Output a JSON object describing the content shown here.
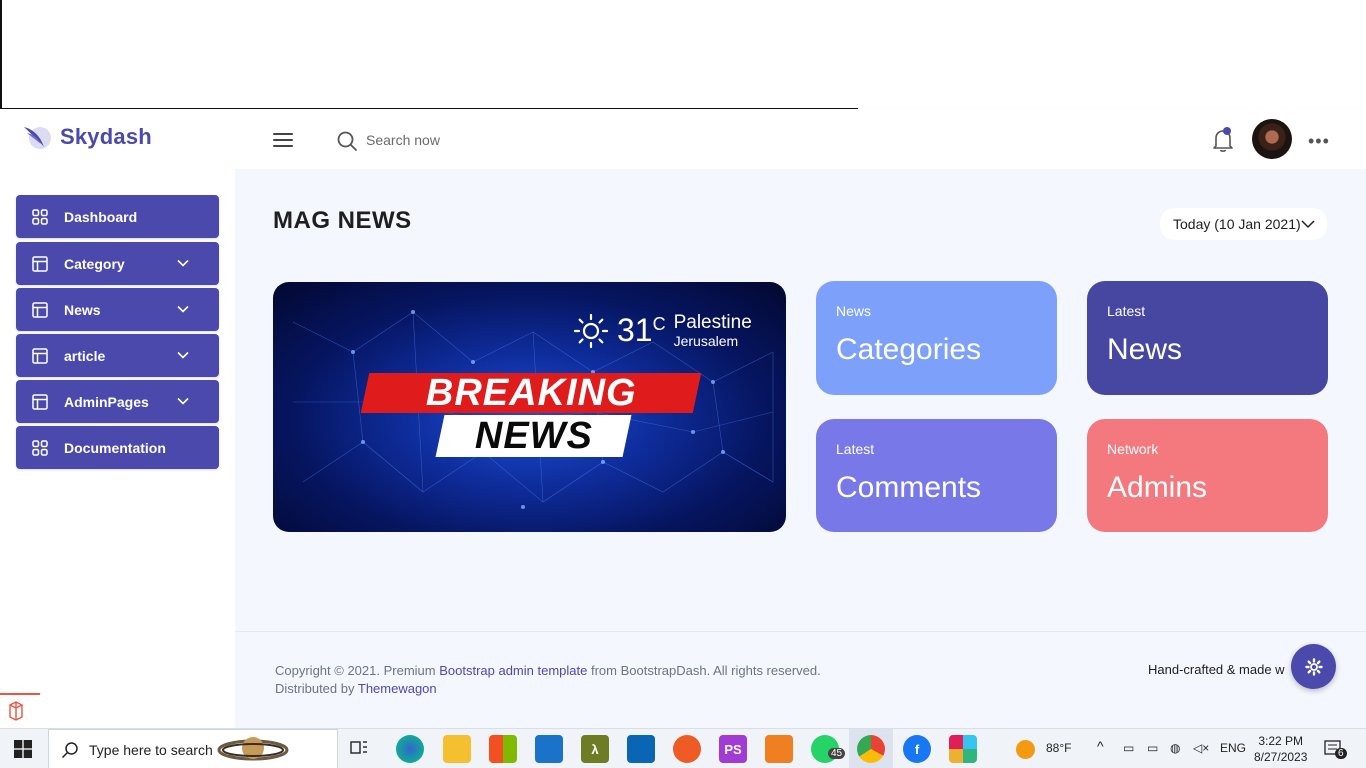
{
  "brand": {
    "name": "Skydash"
  },
  "search": {
    "placeholder": "Search now"
  },
  "sidebar": {
    "items": [
      {
        "label": "Dashboard",
        "icon": "grid-icon",
        "expandable": false
      },
      {
        "label": "Category",
        "icon": "layout-icon",
        "expandable": true
      },
      {
        "label": "News",
        "icon": "layout-icon",
        "expandable": true
      },
      {
        "label": "article",
        "icon": "layout-icon",
        "expandable": true
      },
      {
        "label": "AdminPages",
        "icon": "layout-icon",
        "expandable": true
      },
      {
        "label": "Documentation",
        "icon": "grid-icon",
        "expandable": false
      }
    ]
  },
  "main": {
    "title": "MAG NEWS",
    "date_filter": "Today (10 Jan 2021)",
    "banner": {
      "temperature": "31",
      "unit": "C",
      "city": "Palestine",
      "subcity": "Jerusalem",
      "headline_top": "BREAKING",
      "headline_bottom": "NEWS"
    },
    "cards": [
      {
        "small": "News",
        "big": "Categories",
        "color": "#7da0fa"
      },
      {
        "small": "Latest",
        "big": "News",
        "color": "#4747a1"
      },
      {
        "small": "Latest",
        "big": "Comments",
        "color": "#7978e9"
      },
      {
        "small": "Network",
        "big": "Admins",
        "color": "#f3797e"
      }
    ]
  },
  "footer": {
    "copyright_prefix": "Copyright © 2021. Premium",
    "link_template": "Bootstrap admin template",
    "copyright_suffix": "from BootstrapDash. All rights reserved.",
    "distributed_prefix": "Distributed by",
    "distributed_link": "Themewagon",
    "handcrafted": "Hand-crafted & made w"
  },
  "taskbar": {
    "search_text": "Type here to search",
    "weather": "88°F",
    "language": "ENG",
    "time": "3:22 PM",
    "date": "8/27/2023",
    "whatsapp_badge": "45",
    "notification_count": "6"
  },
  "colors": {
    "primary": "#4b49ac",
    "main_bg": "#f5f7ff"
  }
}
